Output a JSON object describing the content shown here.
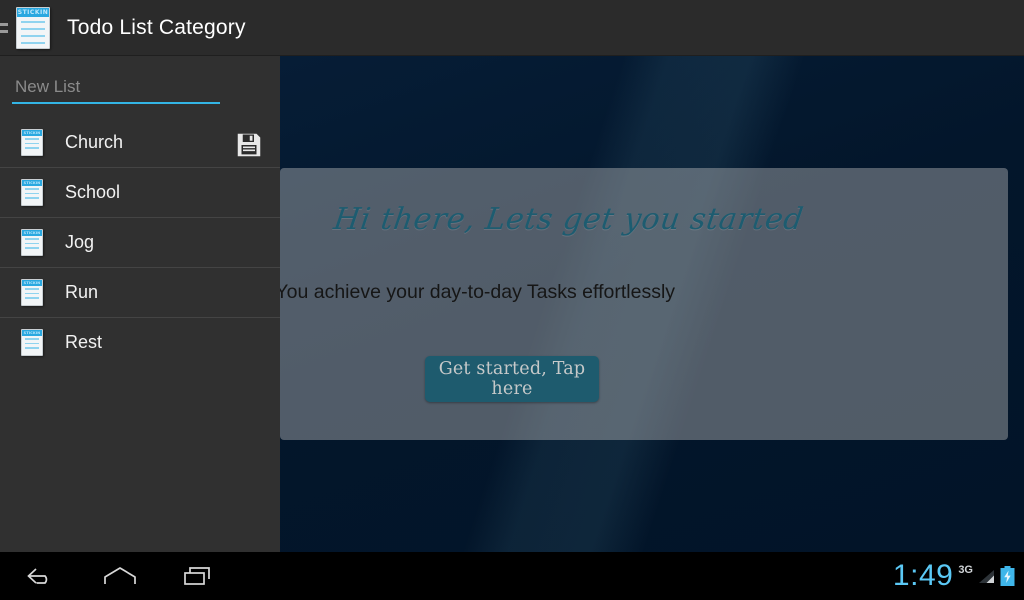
{
  "app": {
    "title": "Todo List Category",
    "icon_name": "notepad-icon",
    "icon_header_text": "STICKIN",
    "drawer_toggle_name": "hamburger-menu-icon"
  },
  "sidebar": {
    "new_list": {
      "placeholder": "New List",
      "value": "",
      "save_label": "save-icon"
    },
    "items": [
      {
        "label": "Church"
      },
      {
        "label": "School"
      },
      {
        "label": "Jog"
      },
      {
        "label": "Run"
      },
      {
        "label": "Rest"
      }
    ]
  },
  "content": {
    "heading": "Hi there, Lets get you started",
    "body": "life more efficiently by ensuring You achieve your day-to-day Tasks effortlessly",
    "cta_label": "Get started, Tap here"
  },
  "navbar": {
    "back_label": "back-icon",
    "home_label": "home-icon",
    "recents_label": "recent-apps-icon"
  },
  "status": {
    "clock": "1:49",
    "network": "3G",
    "signal_label": "signal-icon",
    "battery_label": "battery-charging-icon"
  },
  "colors": {
    "accent_blue": "#33b5e5",
    "clock_blue": "#5bc8f5",
    "heading_teal": "#1d5c70",
    "button_teal": "#1e5b6e",
    "background_navy": "#03162b",
    "sidebar_gray": "#303030"
  }
}
